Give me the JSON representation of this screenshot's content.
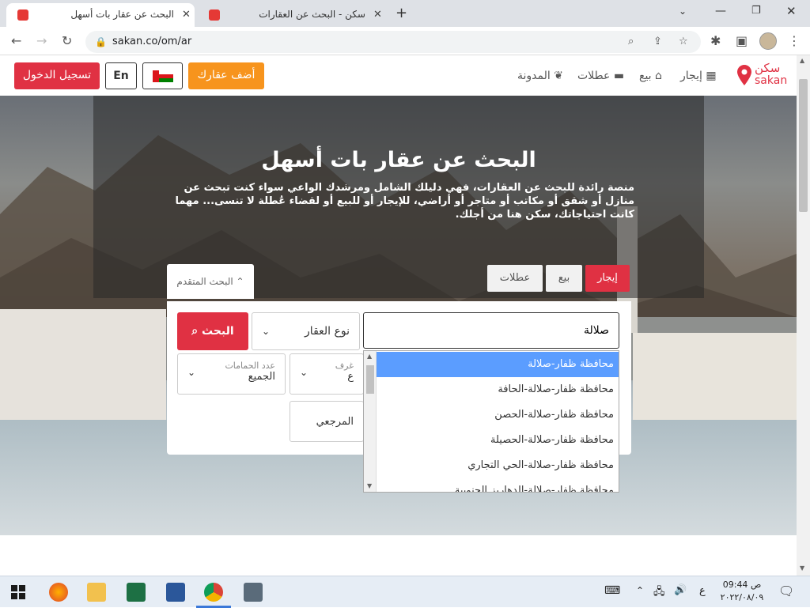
{
  "browser": {
    "tabs": [
      {
        "title": "البحث عن عقار بات أسهل",
        "active": true
      },
      {
        "title": "سكن - البحث عن العقارات",
        "active": false
      }
    ],
    "url": "sakan.co/om/ar"
  },
  "header": {
    "logo_ar": "سكن",
    "logo_en": "sakan",
    "nav": [
      "إيجار",
      "بيع",
      "عطلات",
      "المدونة"
    ],
    "add_property": "أضف عقارك",
    "lang": "En",
    "login": "تسجيل الدخول"
  },
  "hero": {
    "title": "البحث عن عقار بات أسهل",
    "desc": "منصة رائدة للبحث عن العقارات، فهي دليلك الشامل ومرشدك الواعي سواء كنت تبحث عن منازل أو شقق أو مكاتب أو متاجر أو أراضي، للإيجار أو للبيع أو لقضاء عُطلة لا تنسى... مهما كانت احتياجاتك، سكن هنا من أجلك.",
    "modes": {
      "rent": "إيجار",
      "sale": "بيع",
      "holiday": "عطلات"
    },
    "advanced": "البحث المتقدم"
  },
  "search": {
    "query": "صلالة",
    "property_type": "نوع العقار",
    "button": "البحث",
    "rooms_label": "غرف",
    "rooms_value": "ع",
    "bath_label": "عدد الحمامات",
    "bath_value": "الجميع",
    "reference": "المرجعي"
  },
  "dropdown": [
    "محافظة ظفار-صلالة",
    "محافظة ظفار-صلالة-الحافة",
    "محافظة ظفار-صلالة-الحصن",
    "محافظة ظفار-صلالة-الحصيلة",
    "محافظة ظفار-صلالة-الحي التجاري",
    "محافظة ظفار-صلالة-الدهاريز الجنوبية"
  ],
  "taskbar": {
    "time": "09:44 ص",
    "date": "٢٠٢٢/٠٨/٠٩",
    "lang": "ع"
  },
  "colors": {
    "brand": "#e03143",
    "accent": "#f7941d"
  }
}
